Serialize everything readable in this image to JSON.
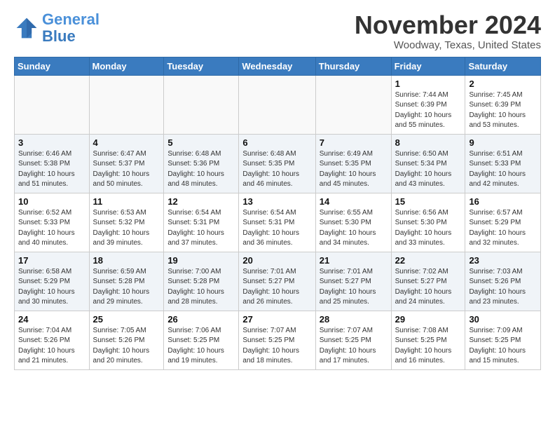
{
  "header": {
    "logo_line1": "General",
    "logo_line2": "Blue",
    "month": "November 2024",
    "location": "Woodway, Texas, United States"
  },
  "weekdays": [
    "Sunday",
    "Monday",
    "Tuesday",
    "Wednesday",
    "Thursday",
    "Friday",
    "Saturday"
  ],
  "weeks": [
    [
      {
        "day": "",
        "info": ""
      },
      {
        "day": "",
        "info": ""
      },
      {
        "day": "",
        "info": ""
      },
      {
        "day": "",
        "info": ""
      },
      {
        "day": "",
        "info": ""
      },
      {
        "day": "1",
        "info": "Sunrise: 7:44 AM\nSunset: 6:39 PM\nDaylight: 10 hours and 55 minutes."
      },
      {
        "day": "2",
        "info": "Sunrise: 7:45 AM\nSunset: 6:39 PM\nDaylight: 10 hours and 53 minutes."
      }
    ],
    [
      {
        "day": "3",
        "info": "Sunrise: 6:46 AM\nSunset: 5:38 PM\nDaylight: 10 hours and 51 minutes."
      },
      {
        "day": "4",
        "info": "Sunrise: 6:47 AM\nSunset: 5:37 PM\nDaylight: 10 hours and 50 minutes."
      },
      {
        "day": "5",
        "info": "Sunrise: 6:48 AM\nSunset: 5:36 PM\nDaylight: 10 hours and 48 minutes."
      },
      {
        "day": "6",
        "info": "Sunrise: 6:48 AM\nSunset: 5:35 PM\nDaylight: 10 hours and 46 minutes."
      },
      {
        "day": "7",
        "info": "Sunrise: 6:49 AM\nSunset: 5:35 PM\nDaylight: 10 hours and 45 minutes."
      },
      {
        "day": "8",
        "info": "Sunrise: 6:50 AM\nSunset: 5:34 PM\nDaylight: 10 hours and 43 minutes."
      },
      {
        "day": "9",
        "info": "Sunrise: 6:51 AM\nSunset: 5:33 PM\nDaylight: 10 hours and 42 minutes."
      }
    ],
    [
      {
        "day": "10",
        "info": "Sunrise: 6:52 AM\nSunset: 5:33 PM\nDaylight: 10 hours and 40 minutes."
      },
      {
        "day": "11",
        "info": "Sunrise: 6:53 AM\nSunset: 5:32 PM\nDaylight: 10 hours and 39 minutes."
      },
      {
        "day": "12",
        "info": "Sunrise: 6:54 AM\nSunset: 5:31 PM\nDaylight: 10 hours and 37 minutes."
      },
      {
        "day": "13",
        "info": "Sunrise: 6:54 AM\nSunset: 5:31 PM\nDaylight: 10 hours and 36 minutes."
      },
      {
        "day": "14",
        "info": "Sunrise: 6:55 AM\nSunset: 5:30 PM\nDaylight: 10 hours and 34 minutes."
      },
      {
        "day": "15",
        "info": "Sunrise: 6:56 AM\nSunset: 5:30 PM\nDaylight: 10 hours and 33 minutes."
      },
      {
        "day": "16",
        "info": "Sunrise: 6:57 AM\nSunset: 5:29 PM\nDaylight: 10 hours and 32 minutes."
      }
    ],
    [
      {
        "day": "17",
        "info": "Sunrise: 6:58 AM\nSunset: 5:29 PM\nDaylight: 10 hours and 30 minutes."
      },
      {
        "day": "18",
        "info": "Sunrise: 6:59 AM\nSunset: 5:28 PM\nDaylight: 10 hours and 29 minutes."
      },
      {
        "day": "19",
        "info": "Sunrise: 7:00 AM\nSunset: 5:28 PM\nDaylight: 10 hours and 28 minutes."
      },
      {
        "day": "20",
        "info": "Sunrise: 7:01 AM\nSunset: 5:27 PM\nDaylight: 10 hours and 26 minutes."
      },
      {
        "day": "21",
        "info": "Sunrise: 7:01 AM\nSunset: 5:27 PM\nDaylight: 10 hours and 25 minutes."
      },
      {
        "day": "22",
        "info": "Sunrise: 7:02 AM\nSunset: 5:27 PM\nDaylight: 10 hours and 24 minutes."
      },
      {
        "day": "23",
        "info": "Sunrise: 7:03 AM\nSunset: 5:26 PM\nDaylight: 10 hours and 23 minutes."
      }
    ],
    [
      {
        "day": "24",
        "info": "Sunrise: 7:04 AM\nSunset: 5:26 PM\nDaylight: 10 hours and 21 minutes."
      },
      {
        "day": "25",
        "info": "Sunrise: 7:05 AM\nSunset: 5:26 PM\nDaylight: 10 hours and 20 minutes."
      },
      {
        "day": "26",
        "info": "Sunrise: 7:06 AM\nSunset: 5:25 PM\nDaylight: 10 hours and 19 minutes."
      },
      {
        "day": "27",
        "info": "Sunrise: 7:07 AM\nSunset: 5:25 PM\nDaylight: 10 hours and 18 minutes."
      },
      {
        "day": "28",
        "info": "Sunrise: 7:07 AM\nSunset: 5:25 PM\nDaylight: 10 hours and 17 minutes."
      },
      {
        "day": "29",
        "info": "Sunrise: 7:08 AM\nSunset: 5:25 PM\nDaylight: 10 hours and 16 minutes."
      },
      {
        "day": "30",
        "info": "Sunrise: 7:09 AM\nSunset: 5:25 PM\nDaylight: 10 hours and 15 minutes."
      }
    ]
  ]
}
